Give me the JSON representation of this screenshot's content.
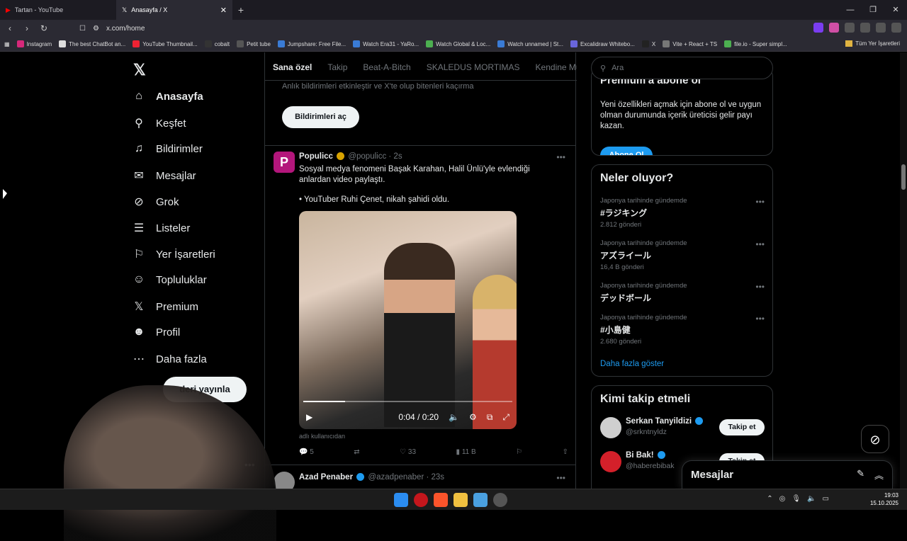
{
  "browser": {
    "tabs": [
      {
        "title": "Tartan - YouTube",
        "active": false
      },
      {
        "title": "Anasayfa / X",
        "active": true
      }
    ],
    "url": "x.com/home",
    "bookmarks": [
      "Instagram",
      "The best ChatBot an...",
      "YouTube Thumbnail...",
      "cobalt",
      "Petit tube",
      "Jumpshare: Free File...",
      "Watch Era31 - YaRo...",
      "Watch Global & Loc...",
      "Watch unnamed | St...",
      "Excalidraw Whitebo...",
      "X",
      "Vite + React + TS",
      "file.io - Super simpl..."
    ],
    "bookmarks_all": "Tüm Yer İşaretleri"
  },
  "nav": {
    "items": [
      {
        "label": "Anasayfa",
        "icon": "home-icon",
        "glyph": "⌂"
      },
      {
        "label": "Keşfet",
        "icon": "search-icon",
        "glyph": "⚲"
      },
      {
        "label": "Bildirimler",
        "icon": "bell-icon",
        "glyph": "🔔"
      },
      {
        "label": "Mesajlar",
        "icon": "mail-icon",
        "glyph": "✉"
      },
      {
        "label": "Grok",
        "icon": "grok-icon",
        "glyph": "⊘"
      },
      {
        "label": "Listeler",
        "icon": "list-icon",
        "glyph": "☰"
      },
      {
        "label": "Yer İşaretleri",
        "icon": "bookmark-icon",
        "glyph": "🔖"
      },
      {
        "label": "Topluluklar",
        "icon": "people-icon",
        "glyph": "👥"
      },
      {
        "label": "Premium",
        "icon": "x-logo-icon",
        "glyph": "𝕏"
      },
      {
        "label": "Profil",
        "icon": "profile-icon",
        "glyph": "👤"
      },
      {
        "label": "Daha fazla",
        "icon": "more-icon",
        "glyph": "⋯"
      }
    ],
    "post_label": "deri yayınla"
  },
  "feed": {
    "tabs": [
      "Sana özel",
      "Takip",
      "Beat-A-Bitch",
      "SKALEDUS MORTIMAS",
      "Kendine Müz"
    ],
    "notif_text": "Anlık bildirimleri etkinleştir ve X'te olup bitenleri kaçırma",
    "notif_button": "Bildirimleri aç",
    "post1": {
      "avatar_letter": "P",
      "name": "Populicc",
      "handle": "@populicc · 2s",
      "text1": "Sosyal medya fenomeni Başak Karahan, Halil Ünlü'yle evlendiği anlardan video paylaştı.",
      "text2": "• YouTuber Ruhi Çenet, nikah şahidi oldu.",
      "video_time": "0:04 / 0:20",
      "video_progress": 0.2,
      "caption": "adlı kullanıcıdan",
      "replies": "5",
      "likes": "33",
      "views": "11 B"
    },
    "post2": {
      "name": "Azad Penaber",
      "handle": "@azadpenaber · 23s"
    }
  },
  "sidebar": {
    "search_placeholder": "Ara",
    "premium_title": "Premium'a abone ol",
    "premium_text": "Yeni özellikleri açmak için abone ol ve uygun olman durumunda içerik üreticisi gelir payı kazan.",
    "subscribe_label": "Abone Ol",
    "trends_title": "Neler oluyor?",
    "trends": [
      {
        "context": "Japonya tarihinde gündemde",
        "title": "#ラジキング",
        "count": "2.812 gönderi"
      },
      {
        "context": "Japonya tarihinde gündemde",
        "title": "アズライール",
        "count": "16,4 B gönderi"
      },
      {
        "context": "Japonya tarihinde gündemde",
        "title": "デッドボール",
        "count": ""
      },
      {
        "context": "Japonya tarihinde gündemde",
        "title": "#小島健",
        "count": "2.680 gönderi"
      }
    ],
    "show_more": "Daha fazla göster",
    "who_title": "Kimi takip etmeli",
    "who": [
      {
        "name": "Serkan Tanyildizi",
        "handle": "@srkntnyldz",
        "follow": "Takip et",
        "color": "#cfcfcf"
      },
      {
        "name": "Bi Bak!",
        "handle": "@haberebibak",
        "follow": "Takip et",
        "color": "#d4202a"
      }
    ]
  },
  "messages_drawer": "Mesajlar",
  "taskbar": {
    "time": "19:03",
    "date": "15.10.2025"
  }
}
